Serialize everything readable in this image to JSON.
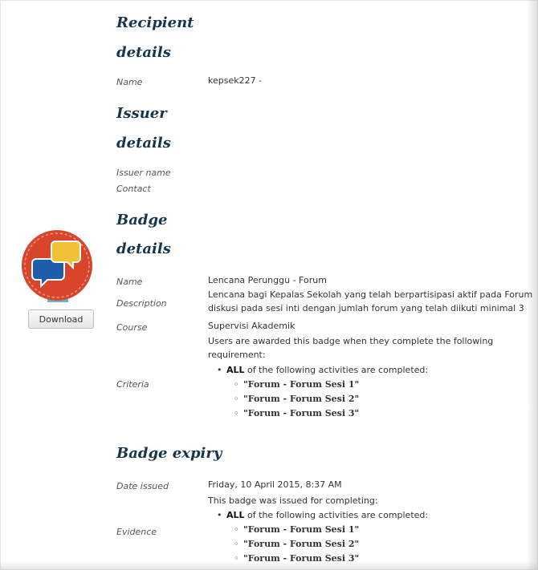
{
  "recipient": {
    "heading1": "Recipient",
    "heading2": "details",
    "name_label": "Name",
    "name_value": "kepsek227 -"
  },
  "issuer": {
    "heading1": "Issuer",
    "heading2": "details",
    "issuer_name_label": "Issuer name",
    "contact_label": "Contact"
  },
  "badge": {
    "heading1": "Badge",
    "heading2": "details",
    "download_label": "Download",
    "icon": "speech-bubbles-badge-icon",
    "name_label": "Name",
    "name_value": "Lencana Perunggu - Forum",
    "description_label": "Description",
    "description_line1": "Lencana bagi Kepalas Sekolah yang telah berpartisipasi aktif pada Forum",
    "description_line2": "diskusi pada sesi inti dengan jumlah forum yang telah diikuti minimal 3",
    "course_label": "Course",
    "course_value": "Supervisi Akademik",
    "criteria_label": "Criteria",
    "criteria_intro_line1": "Users are awarded this badge when they complete the following",
    "criteria_intro_line2": "requirement:",
    "criteria_all": "ALL",
    "criteria_rule": "of the following activities are completed:",
    "criteria_activities": [
      "\"Forum - Forum Sesi 1\"",
      "\"Forum - Forum Sesi 2\"",
      "\"Forum - Forum Sesi 3\""
    ]
  },
  "expiry": {
    "heading": "Badge expiry",
    "date_label": "Date issued",
    "date_value": "Friday, 10 April 2015, 8:37 AM",
    "evidence_label": "Evidence",
    "evidence_intro": "This badge was issued for completing:",
    "evidence_all": "ALL",
    "evidence_rule": "of the following activities are completed:",
    "evidence_activities": [
      "\"Forum - Forum Sesi 1\"",
      "\"Forum - Forum Sesi 2\"",
      "\"Forum - Forum Sesi 3\""
    ]
  },
  "colors": {
    "heading": "#17364e",
    "badge_red": "#d8452a",
    "badge_blue": "#1e5da8",
    "badge_yellow": "#f2c037",
    "ribbon": "#5fb6d6"
  }
}
